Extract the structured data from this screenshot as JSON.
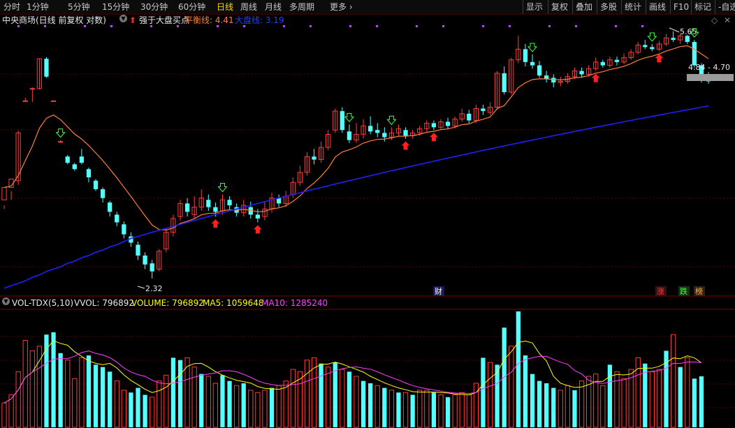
{
  "toolbar": {
    "left_items": [
      "分时",
      "1分钟",
      "5分钟",
      "15分钟",
      "30分钟",
      "60分钟",
      "日线",
      "周线",
      "月线",
      "多周期",
      "更多"
    ],
    "active_item": "日线",
    "right_items": [
      "显示",
      "复权",
      "叠加",
      "多股",
      "统计",
      "画线",
      "F10",
      "标记",
      "-自选"
    ]
  },
  "info": {
    "stock_name": "中央商场(日线 前复权 对数)",
    "indicator_name": "强于大盘买点",
    "balance_label": "平衡线: 4.41",
    "market_label": "大盘线: 3.19"
  },
  "price_labels": {
    "high": "5.65",
    "low": "2.32",
    "range": "4.84 - 4.70"
  },
  "badges": {
    "cai": "财",
    "zhang": "涨",
    "die": "跌",
    "bang": "榜"
  },
  "volume_header": {
    "name": "VOL-TDX(5,10)",
    "vvol": "VVOL: 796892",
    "volume": "VOLUME: 796892",
    "ma5": "MA5: 1059648",
    "ma10": "MA10: 1285240"
  },
  "colors": {
    "up": "#ff3c3c",
    "down": "#54ffff",
    "balance_line": "#ff7e3c",
    "market_line": "#2020ff",
    "ma5": "#ffff00",
    "ma10": "#ff40ff",
    "active": "#ffd700"
  },
  "candles": [
    [
      3.08,
      3.22,
      3.02,
      2.98,
      2.24
    ],
    [
      3.22,
      3.32,
      3.18,
      3.08,
      2.26
    ],
    [
      3.3,
      3.92,
      3.95,
      3.25,
      2.28
    ],
    [
      4.4,
      4.4,
      4.45,
      4.4,
      2.3
    ],
    [
      4.6,
      4.6,
      4.62,
      4.38,
      2.33
    ],
    [
      4.6,
      5.12,
      5.12,
      4.58,
      2.35
    ],
    [
      5.12,
      4.8,
      5.15,
      4.78,
      2.38
    ],
    [
      4.4,
      4.4,
      4.4,
      4.4,
      2.4
    ],
    [
      3.8,
      3.8,
      3.82,
      3.78,
      2.42
    ],
    [
      3.6,
      3.52,
      3.62,
      3.5,
      2.45
    ],
    [
      3.5,
      3.44,
      3.52,
      3.42,
      2.47
    ],
    [
      3.6,
      3.52,
      3.7,
      3.5,
      2.5
    ],
    [
      3.44,
      3.34,
      3.46,
      3.28,
      2.52
    ],
    [
      3.3,
      3.2,
      3.32,
      3.18,
      2.55
    ],
    [
      3.2,
      3.1,
      3.22,
      3.05,
      2.57
    ],
    [
      3.05,
      2.95,
      3.07,
      2.9,
      2.6
    ],
    [
      2.92,
      2.84,
      2.95,
      2.8,
      2.62
    ],
    [
      2.82,
      2.72,
      2.85,
      2.68,
      2.65
    ],
    [
      2.7,
      2.64,
      2.74,
      2.6,
      2.68
    ],
    [
      2.62,
      2.52,
      2.65,
      2.48,
      2.7
    ],
    [
      2.52,
      2.44,
      2.55,
      2.4,
      2.72
    ],
    [
      2.45,
      2.38,
      2.48,
      2.32,
      2.74
    ],
    [
      2.4,
      2.56,
      2.58,
      2.38,
      2.76
    ],
    [
      2.58,
      2.74,
      2.78,
      2.55,
      2.78
    ],
    [
      2.74,
      2.88,
      2.92,
      2.7,
      2.8
    ],
    [
      2.9,
      3.04,
      3.08,
      2.86,
      2.82
    ],
    [
      3.04,
      2.95,
      3.1,
      2.9,
      2.84
    ],
    [
      2.92,
      3.0,
      3.12,
      2.88,
      2.86
    ],
    [
      3.0,
      3.1,
      3.2,
      2.96,
      2.88
    ],
    [
      3.08,
      3.0,
      3.14,
      2.96,
      2.9
    ],
    [
      3.0,
      2.95,
      3.05,
      2.9,
      2.92
    ],
    [
      2.96,
      3.08,
      3.14,
      2.92,
      2.94
    ],
    [
      3.08,
      3.02,
      3.12,
      2.98,
      2.96
    ],
    [
      3.0,
      2.94,
      3.04,
      2.9,
      2.98
    ],
    [
      2.94,
      3.02,
      3.08,
      2.9,
      3.0
    ],
    [
      3.0,
      2.92,
      3.06,
      2.88,
      3.02
    ],
    [
      2.92,
      2.88,
      2.98,
      2.84,
      3.04
    ],
    [
      2.9,
      2.98,
      3.06,
      2.86,
      3.06
    ],
    [
      2.98,
      3.1,
      3.16,
      2.94,
      3.08
    ],
    [
      3.1,
      3.04,
      3.14,
      3.0,
      3.1
    ],
    [
      3.04,
      3.12,
      3.18,
      3.0,
      3.12
    ],
    [
      3.14,
      3.28,
      3.34,
      3.1,
      3.14
    ],
    [
      3.28,
      3.4,
      3.48,
      3.24,
      3.16
    ],
    [
      3.4,
      3.6,
      3.66,
      3.36,
      3.18
    ],
    [
      3.6,
      3.56,
      3.7,
      3.5,
      3.2
    ],
    [
      3.56,
      3.72,
      3.8,
      3.52,
      3.22
    ],
    [
      3.72,
      3.9,
      3.96,
      3.68,
      3.24
    ],
    [
      3.96,
      4.24,
      4.28,
      3.92,
      3.26
    ],
    [
      4.24,
      3.96,
      4.3,
      3.92,
      3.28
    ],
    [
      3.94,
      3.82,
      4.04,
      3.78,
      3.3
    ],
    [
      3.82,
      3.9,
      4.06,
      3.78,
      3.32
    ],
    [
      3.9,
      4.02,
      4.12,
      3.84,
      3.34
    ],
    [
      4.02,
      3.94,
      4.16,
      3.9,
      3.36
    ],
    [
      3.96,
      3.92,
      4.06,
      3.86,
      3.38
    ],
    [
      3.92,
      3.86,
      4.0,
      3.8,
      3.4
    ],
    [
      3.86,
      3.92,
      4.0,
      3.82,
      3.42
    ],
    [
      3.92,
      3.98,
      4.04,
      3.88,
      3.44
    ],
    [
      3.96,
      3.88,
      4.0,
      3.84,
      3.46
    ],
    [
      3.88,
      3.92,
      3.96,
      3.84,
      3.48
    ],
    [
      3.92,
      3.98,
      4.02,
      3.88,
      3.5
    ],
    [
      3.98,
      4.06,
      4.1,
      3.94,
      3.52
    ],
    [
      4.06,
      4.0,
      4.1,
      3.96,
      3.54
    ],
    [
      4.0,
      4.08,
      4.12,
      3.96,
      3.56
    ],
    [
      4.08,
      4.02,
      4.14,
      3.98,
      3.58
    ],
    [
      4.02,
      4.12,
      4.16,
      3.98,
      3.6
    ],
    [
      4.12,
      4.2,
      4.28,
      4.08,
      3.62
    ],
    [
      4.2,
      4.1,
      4.26,
      4.06,
      3.64
    ],
    [
      4.1,
      4.28,
      4.34,
      4.06,
      3.66
    ],
    [
      4.28,
      4.24,
      4.34,
      4.18,
      3.68
    ],
    [
      4.22,
      4.3,
      4.38,
      4.18,
      3.7
    ],
    [
      4.3,
      4.86,
      4.9,
      4.26,
      3.72
    ],
    [
      4.86,
      4.54,
      4.98,
      4.5,
      3.74
    ],
    [
      4.54,
      5.1,
      5.14,
      4.5,
      3.76
    ],
    [
      5.1,
      5.3,
      5.56,
      5.04,
      3.78
    ],
    [
      5.3,
      5.06,
      5.4,
      4.98,
      3.8
    ],
    [
      5.06,
      5.0,
      5.2,
      4.94,
      3.82
    ],
    [
      5.0,
      4.82,
      5.08,
      4.78,
      3.84
    ],
    [
      4.82,
      4.76,
      4.9,
      4.7,
      3.86
    ],
    [
      4.78,
      4.7,
      4.84,
      4.62,
      3.88
    ],
    [
      4.7,
      4.72,
      4.8,
      4.64,
      3.9
    ],
    [
      4.72,
      4.8,
      4.86,
      4.68,
      3.92
    ],
    [
      4.8,
      4.9,
      4.96,
      4.76,
      3.94
    ],
    [
      4.9,
      4.84,
      4.96,
      4.78,
      3.96
    ],
    [
      4.84,
      4.94,
      5.0,
      4.8,
      3.98
    ],
    [
      4.94,
      5.06,
      5.14,
      4.9,
      4.0
    ],
    [
      5.06,
      5.0,
      5.1,
      4.96,
      4.02
    ],
    [
      5.0,
      5.1,
      5.16,
      4.96,
      4.04
    ],
    [
      5.1,
      5.06,
      5.16,
      5.0,
      4.06
    ],
    [
      5.06,
      5.14,
      5.22,
      5.02,
      4.08
    ],
    [
      5.14,
      5.24,
      5.3,
      5.1,
      4.1
    ],
    [
      5.24,
      5.38,
      5.44,
      5.2,
      4.12
    ],
    [
      5.38,
      5.34,
      5.48,
      5.3,
      4.14
    ],
    [
      5.34,
      5.3,
      5.4,
      5.26,
      4.16
    ],
    [
      5.3,
      5.4,
      5.46,
      5.26,
      4.18
    ],
    [
      5.4,
      5.52,
      5.6,
      5.36,
      4.2
    ],
    [
      5.52,
      5.48,
      5.65,
      5.44,
      4.22
    ],
    [
      5.48,
      5.56,
      5.6,
      5.4,
      4.24
    ],
    [
      5.56,
      5.44,
      5.58,
      5.4,
      4.26
    ],
    [
      5.44,
      5.0,
      5.48,
      4.96,
      4.28
    ],
    [
      5.0,
      4.8,
      5.04,
      4.7,
      4.3
    ],
    [
      4.8,
      4.72,
      4.88,
      4.68,
      4.32
    ]
  ],
  "volumes": [
    [
      21,
      1
    ],
    [
      28,
      1
    ],
    [
      48,
      1
    ],
    [
      75,
      1
    ],
    [
      66,
      1
    ],
    [
      70,
      1
    ],
    [
      80,
      0
    ],
    [
      82,
      0
    ],
    [
      64,
      0
    ],
    [
      58,
      1
    ],
    [
      42,
      1
    ],
    [
      60,
      1
    ],
    [
      62,
      0
    ],
    [
      54,
      0
    ],
    [
      52,
      0
    ],
    [
      48,
      0
    ],
    [
      40,
      1
    ],
    [
      32,
      1
    ],
    [
      30,
      0
    ],
    [
      34,
      0
    ],
    [
      28,
      0
    ],
    [
      26,
      1
    ],
    [
      40,
      1
    ],
    [
      45,
      1
    ],
    [
      60,
      0
    ],
    [
      58,
      0
    ],
    [
      60,
      1
    ],
    [
      52,
      1
    ],
    [
      46,
      0
    ],
    [
      44,
      1
    ],
    [
      38,
      1
    ],
    [
      45,
      0
    ],
    [
      40,
      0
    ],
    [
      36,
      1
    ],
    [
      38,
      0
    ],
    [
      32,
      1
    ],
    [
      30,
      1
    ],
    [
      32,
      1
    ],
    [
      34,
      0
    ],
    [
      36,
      1
    ],
    [
      40,
      1
    ],
    [
      50,
      1
    ],
    [
      48,
      1
    ],
    [
      58,
      1
    ],
    [
      60,
      1
    ],
    [
      55,
      0
    ],
    [
      52,
      1
    ],
    [
      56,
      0
    ],
    [
      50,
      1
    ],
    [
      48,
      0
    ],
    [
      44,
      1
    ],
    [
      40,
      0
    ],
    [
      38,
      0
    ],
    [
      36,
      1
    ],
    [
      34,
      0
    ],
    [
      32,
      1
    ],
    [
      30,
      0
    ],
    [
      30,
      1
    ],
    [
      28,
      0
    ],
    [
      32,
      1
    ],
    [
      32,
      1
    ],
    [
      30,
      0
    ],
    [
      28,
      1
    ],
    [
      26,
      0
    ],
    [
      28,
      1
    ],
    [
      30,
      1
    ],
    [
      28,
      1
    ],
    [
      38,
      1
    ],
    [
      60,
      0
    ],
    [
      56,
      1
    ],
    [
      54,
      0
    ],
    [
      86,
      0
    ],
    [
      70,
      1
    ],
    [
      100,
      0
    ],
    [
      62,
      0
    ],
    [
      46,
      0
    ],
    [
      40,
      0
    ],
    [
      38,
      0
    ],
    [
      34,
      0
    ],
    [
      32,
      1
    ],
    [
      36,
      1
    ],
    [
      32,
      0
    ],
    [
      40,
      1
    ],
    [
      44,
      1
    ],
    [
      46,
      1
    ],
    [
      36,
      1
    ],
    [
      54,
      0
    ],
    [
      48,
      1
    ],
    [
      42,
      1
    ],
    [
      50,
      1
    ],
    [
      60,
      1
    ],
    [
      55,
      0
    ],
    [
      48,
      1
    ],
    [
      50,
      1
    ],
    [
      66,
      0
    ],
    [
      80,
      1
    ],
    [
      52,
      0
    ],
    [
      60,
      1
    ],
    [
      42,
      0
    ],
    [
      44,
      0
    ]
  ],
  "signals": [
    {
      "i": 8,
      "type": "sell"
    },
    {
      "i": 31,
      "type": "sell"
    },
    {
      "i": 30,
      "type": "buy"
    },
    {
      "i": 36,
      "type": "buy"
    },
    {
      "i": 49,
      "type": "sell"
    },
    {
      "i": 55,
      "type": "sell"
    },
    {
      "i": 57,
      "type": "buy"
    },
    {
      "i": 61,
      "type": "buy"
    },
    {
      "i": 75,
      "type": "sell"
    },
    {
      "i": 84,
      "type": "buy"
    },
    {
      "i": 92,
      "type": "sell"
    },
    {
      "i": 93,
      "type": "buy"
    },
    {
      "i": 98,
      "type": "sell"
    }
  ]
}
